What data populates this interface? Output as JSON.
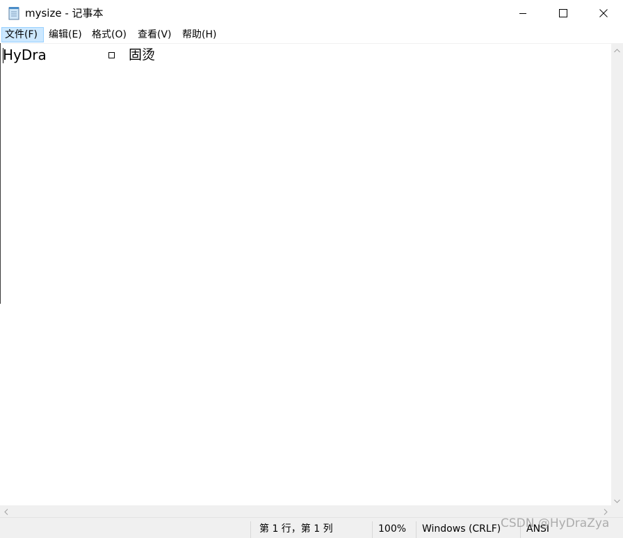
{
  "window": {
    "title": "mysize - 记事本",
    "icon": "notepad-icon",
    "controls": {
      "minimize": "minimize-icon",
      "maximize": "maximize-icon",
      "close": "close-icon"
    }
  },
  "menu": {
    "items": [
      {
        "label": "文件(F)"
      },
      {
        "label": "编辑(E)"
      },
      {
        "label": "格式(O)"
      },
      {
        "label": "查看(V)"
      },
      {
        "label": "帮助(H)"
      }
    ]
  },
  "editor": {
    "text_latin": "HyDra",
    "text_cjk": "固烫"
  },
  "status": {
    "position": "第 1 行，第 1 列",
    "zoom": "100%",
    "line_ending": "Windows (CRLF)",
    "encoding": "ANSI"
  },
  "watermark": "CSDN @HyDraZya",
  "colors": {
    "menu_active_bg": "#cce8ff",
    "menu_active_border": "#99d1ff",
    "chrome_bg": "#f0f0f0"
  }
}
